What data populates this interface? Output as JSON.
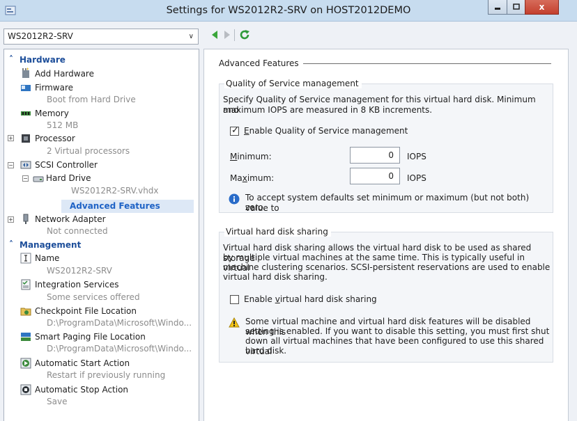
{
  "window": {
    "title": "Settings for WS2012R2-SRV on HOST2012DEMO",
    "close_glyph": "x"
  },
  "vm_selector": {
    "value": "WS2012R2-SRV"
  },
  "sidebar": {
    "hardware_header": "Hardware",
    "add_hardware": "Add Hardware",
    "firmware": {
      "label": "Firmware",
      "sub": "Boot from Hard Drive"
    },
    "memory": {
      "label": "Memory",
      "sub": "512 MB"
    },
    "processor": {
      "label": "Processor",
      "sub": "2 Virtual processors"
    },
    "scsi": {
      "label": "SCSI Controller"
    },
    "hard_drive": {
      "label": "Hard Drive",
      "sub": "WS2012R2-SRV.vhdx"
    },
    "advanced_features": "Advanced Features",
    "network": {
      "label": "Network Adapter",
      "sub": "Not connected"
    },
    "management_header": "Management",
    "name": {
      "label": "Name",
      "sub": "WS2012R2-SRV"
    },
    "integration": {
      "label": "Integration Services",
      "sub": "Some services offered"
    },
    "checkpoint": {
      "label": "Checkpoint File Location",
      "sub": "D:\\ProgramData\\Microsoft\\Windo..."
    },
    "paging": {
      "label": "Smart Paging File Location",
      "sub": "D:\\ProgramData\\Microsoft\\Windo..."
    },
    "auto_start": {
      "label": "Automatic Start Action",
      "sub": "Restart if previously running"
    },
    "auto_stop": {
      "label": "Automatic Stop Action",
      "sub": "Save"
    }
  },
  "main": {
    "section_title": "Advanced Features",
    "qos": {
      "group_label": "Quality of Service management",
      "description_line1": "Specify Quality of Service management for this virtual hard disk. Minimum and",
      "description_line2": "maximum IOPS are measured in 8 KB increments.",
      "enable_label_first": "E",
      "enable_label_rest": "nable Quality of Service management",
      "enabled": true,
      "min_label_a": "M",
      "min_label_b": "inimum:",
      "min_value": "0",
      "max_label_a": "Ma",
      "max_label_b": "x",
      "max_label_c": "imum:",
      "max_value": "0",
      "unit": "IOPS",
      "info_line1": "To accept system defaults set minimum or maximum (but not both) value to",
      "info_line2": "zero."
    },
    "sharing": {
      "group_label": "Virtual hard disk sharing",
      "desc_line1": "Virtual hard disk sharing allows the virtual hard disk to be used as shared storage",
      "desc_line2": "by multiple virtual machines at the same time. This is typically useful in virtual",
      "desc_line3": "machine clustering scenarios. SCSI-persistent reservations are used to enable",
      "desc_line4": "virtual hard disk sharing.",
      "enable_a": "Enable ",
      "enable_b": "v",
      "enable_c": "irtual hard disk sharing",
      "enabled": false,
      "warn_line1": "Some virtual machine and virtual hard disk features will be disabled when this",
      "warn_line2": "setting is enabled. If you want to disable this setting, you must first shut",
      "warn_line3": "down all virtual machines that have been configured to use this shared virtual",
      "warn_line4": "hard disk."
    }
  },
  "colors": {
    "accent": "#1d4e9a",
    "selected_bg": "#dde8f6",
    "nav_green": "#3aa63a"
  }
}
